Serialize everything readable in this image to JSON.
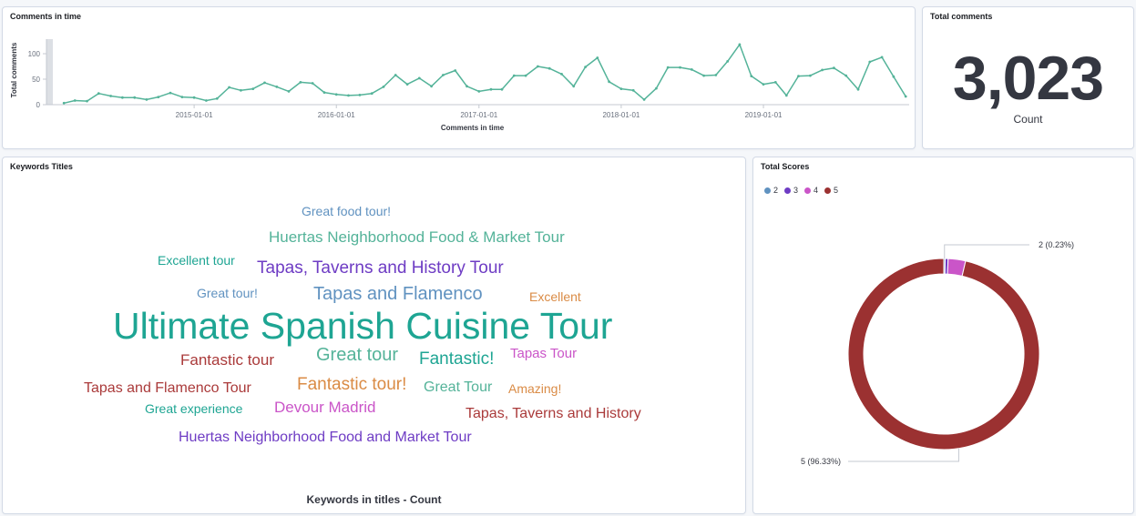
{
  "panels": {
    "line": {
      "title": "Comments in time"
    },
    "total": {
      "title": "Total comments",
      "value": "3,023",
      "label": "Count"
    },
    "words": {
      "title": "Keywords Titles",
      "footer": "Keywords in titles - Count"
    },
    "pie": {
      "title": "Total Scores"
    }
  },
  "chart_data": [
    {
      "type": "line",
      "title": "Comments in time",
      "xlabel": "Comments in time",
      "ylabel": "Total comments",
      "color": "#54b399",
      "x_ticks": [
        "2015-01-01",
        "2016-01-01",
        "2017-01-01",
        "2018-01-01",
        "2019-01-01"
      ],
      "y_ticks": [
        0,
        50,
        100
      ],
      "ylim": [
        0,
        125
      ],
      "x_start": "2014-02-01",
      "values": [
        3,
        8,
        7,
        22,
        17,
        14,
        14,
        10,
        15,
        23,
        15,
        14,
        8,
        12,
        34,
        28,
        31,
        43,
        35,
        26,
        44,
        42,
        24,
        20,
        18,
        19,
        22,
        35,
        58,
        40,
        52,
        36,
        58,
        67,
        36,
        26,
        30,
        30,
        57,
        57,
        75,
        71,
        60,
        36,
        74,
        92,
        45,
        31,
        28,
        10,
        32,
        73,
        73,
        69,
        57,
        58,
        85,
        118,
        56,
        40,
        44,
        18,
        56,
        57,
        68,
        72,
        57,
        30,
        84,
        93,
        55,
        16
      ]
    },
    {
      "type": "pie",
      "title": "Total Scores",
      "legend": [
        "2",
        "3",
        "4",
        "5"
      ],
      "colors": [
        "#6092c0",
        "#6e3cc4",
        "#d36086",
        "#9b3131"
      ],
      "slices": [
        {
          "label": "2",
          "value": 0.23,
          "color": "#6092c0"
        },
        {
          "label": "3",
          "value": 0.5,
          "color": "#6e3cc4"
        },
        {
          "label": "4",
          "value": 2.94,
          "color": "#ca55c8"
        },
        {
          "label": "5",
          "value": 96.33,
          "color": "#9b3131"
        }
      ],
      "callouts": [
        "2 (0.23%)",
        "5 (96.33%)"
      ]
    },
    {
      "type": "wordcloud",
      "title": "Keywords Titles",
      "words": [
        {
          "text": "Great food tour!",
          "color": "#6092c0"
        },
        {
          "text": "Huertas Neighborhood Food & Market Tour",
          "color": "#54b399"
        },
        {
          "text": "Excellent tour",
          "color": "#1ea593"
        },
        {
          "text": "Tapas, Taverns and History Tour",
          "color": "#6e3cc4"
        },
        {
          "text": "Great tour!",
          "color": "#6092c0"
        },
        {
          "text": "Tapas and Flamenco",
          "color": "#6092c0"
        },
        {
          "text": "Excellent",
          "color": "#da8b45"
        },
        {
          "text": "Ultimate Spanish Cuisine Tour",
          "color": "#1ea593"
        },
        {
          "text": "Fantastic tour",
          "color": "#aa3a3a"
        },
        {
          "text": "Great tour",
          "color": "#54b399"
        },
        {
          "text": "Fantastic!",
          "color": "#1ea593"
        },
        {
          "text": "Tapas Tour",
          "color": "#ca55c8"
        },
        {
          "text": "Tapas and Flamenco Tour",
          "color": "#aa3a3a"
        },
        {
          "text": "Fantastic tour!",
          "color": "#da8b45"
        },
        {
          "text": "Great Tour",
          "color": "#54b399"
        },
        {
          "text": "Amazing!",
          "color": "#da8b45"
        },
        {
          "text": "Great experience",
          "color": "#1ea593"
        },
        {
          "text": "Devour Madrid",
          "color": "#ca55c8"
        },
        {
          "text": "Tapas, Taverns and History",
          "color": "#aa3a3a"
        },
        {
          "text": "Huertas Neighborhood Food and Market Tour",
          "color": "#6e3cc4"
        }
      ]
    }
  ]
}
